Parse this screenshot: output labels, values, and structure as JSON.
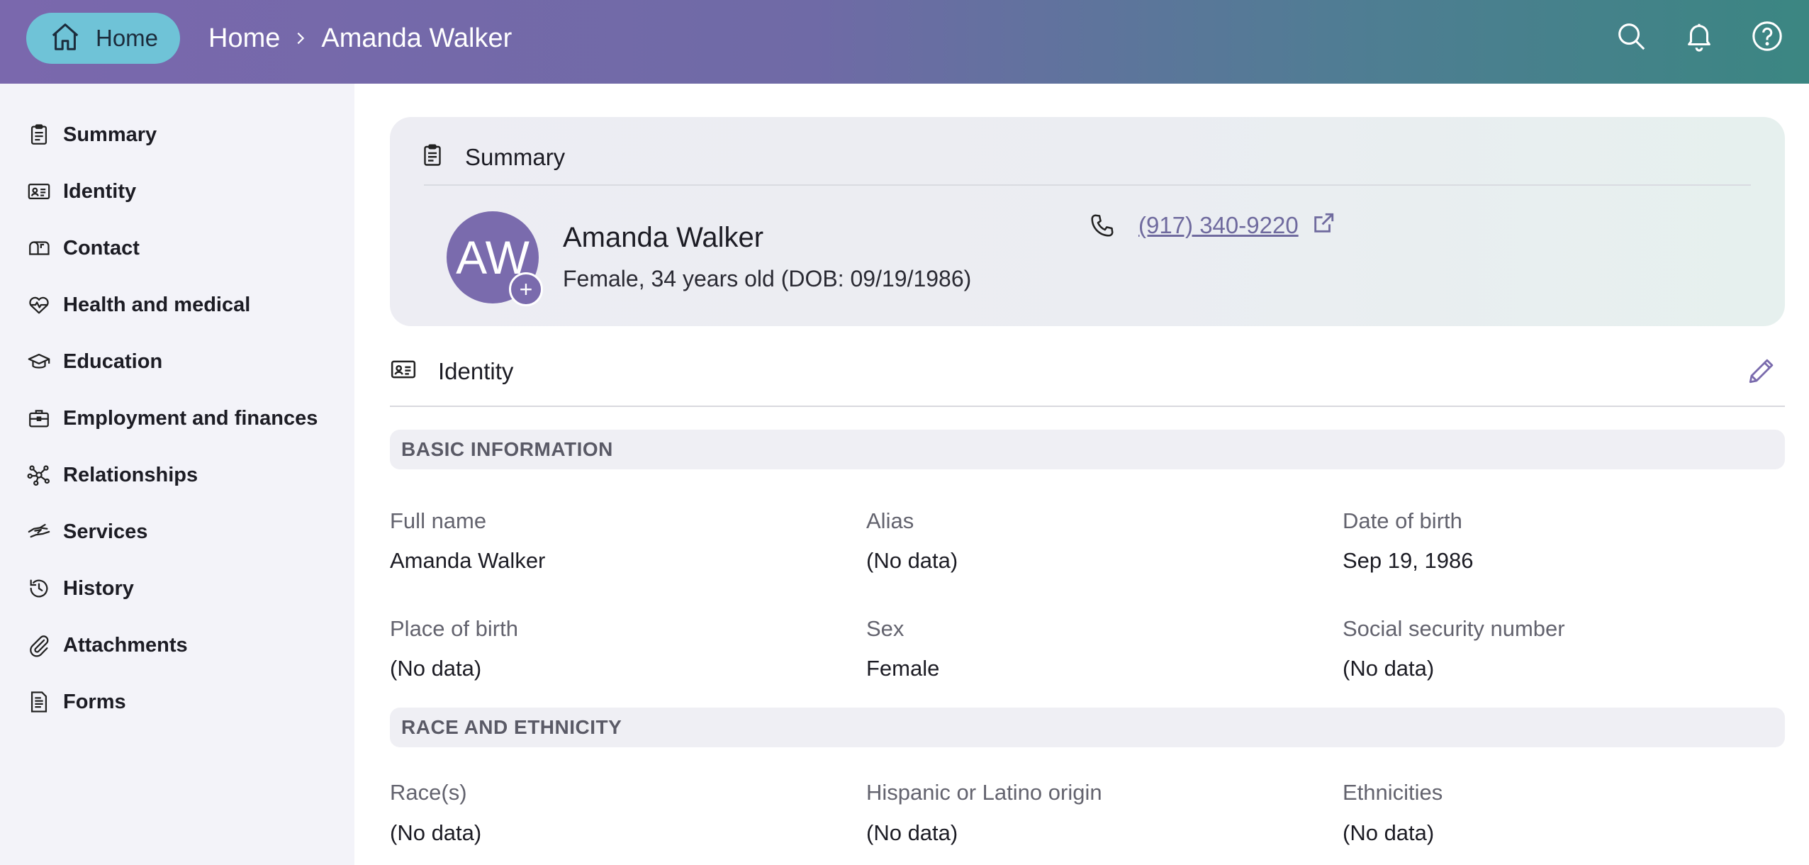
{
  "header": {
    "home_label": "Home",
    "breadcrumb": [
      "Home",
      "Amanda Walker"
    ],
    "icons": [
      "search-icon",
      "bell-icon",
      "help-icon"
    ],
    "gradient_colors": [
      "#7a68ad",
      "#3b8682"
    ],
    "home_pill_color": "#6fc3d7"
  },
  "sidebar": {
    "items": [
      {
        "label": "Summary",
        "icon": "clipboard-icon"
      },
      {
        "label": "Identity",
        "icon": "id-card-icon"
      },
      {
        "label": "Contact",
        "icon": "mailbox-icon"
      },
      {
        "label": "Health and medical",
        "icon": "heart-pulse-icon"
      },
      {
        "label": "Education",
        "icon": "graduation-cap-icon"
      },
      {
        "label": "Employment and finances",
        "icon": "briefcase-icon"
      },
      {
        "label": "Relationships",
        "icon": "network-icon"
      },
      {
        "label": "Services",
        "icon": "handshake-icon"
      },
      {
        "label": "History",
        "icon": "history-icon"
      },
      {
        "label": "Attachments",
        "icon": "paperclip-icon"
      },
      {
        "label": "Forms",
        "icon": "form-icon"
      }
    ]
  },
  "summary": {
    "title": "Summary",
    "avatar_initials": "AW",
    "avatar_color": "#7a6bad",
    "name": "Amanda Walker",
    "details": "Female, 34 years old (DOB: 09/19/1986)",
    "phone": "(917) 340-9220"
  },
  "identity": {
    "title": "Identity",
    "basic": {
      "heading": "BASIC INFORMATION",
      "fields": [
        {
          "label": "Full name",
          "value": "Amanda Walker"
        },
        {
          "label": "Alias",
          "value": "(No data)"
        },
        {
          "label": "Date of birth",
          "value": "Sep 19, 1986"
        },
        {
          "label": "Place of birth",
          "value": "(No data)"
        },
        {
          "label": "Sex",
          "value": "Female"
        },
        {
          "label": "Social security number",
          "value": "(No data)"
        }
      ]
    },
    "race": {
      "heading": "RACE AND ETHNICITY",
      "fields": [
        {
          "label": "Race(s)",
          "value": "(No data)"
        },
        {
          "label": "Hispanic or Latino origin",
          "value": "(No data)"
        },
        {
          "label": "Ethnicities",
          "value": "(No data)"
        }
      ]
    }
  }
}
